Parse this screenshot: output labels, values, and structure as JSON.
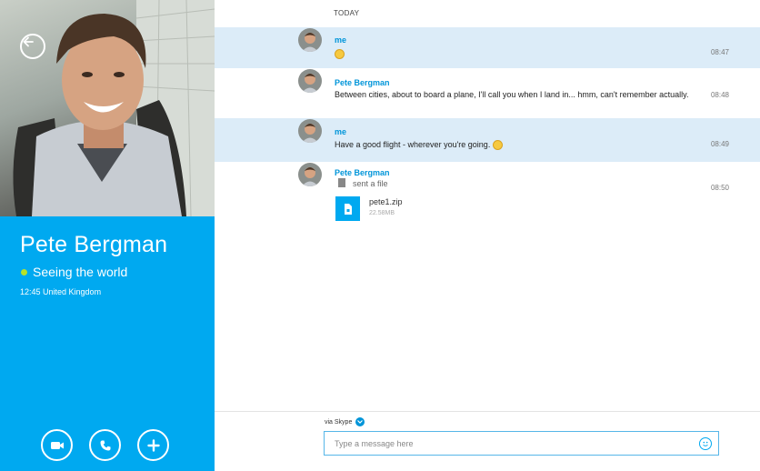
{
  "contact": {
    "name": "Pete Bergman",
    "mood": "Seeing the world",
    "local_info": "12:45 United Kingdom"
  },
  "icons": {
    "back": "back-arrow-icon",
    "video": "video-call-icon",
    "call": "phone-icon",
    "add": "plus-icon"
  },
  "colors": {
    "accent": "#00a9f0",
    "sender": "#0095d9",
    "mine_bg": "#dcecf8",
    "status_online": "#b6e22a"
  },
  "conversation": {
    "day_label": "TODAY",
    "messages": [
      {
        "sender": "me",
        "text": "",
        "emoticon": "smile",
        "time": "08:47"
      },
      {
        "sender": "Pete Bergman",
        "text": "Between cities, about to board a plane, I'll call you when I land in... hmm, can't remember actually.",
        "time": "08:48"
      },
      {
        "sender": "me",
        "text": "Have a good flight - wherever you're going.",
        "emoticon": "grin",
        "time": "08:49"
      },
      {
        "sender": "Pete Bergman",
        "text": "sent a file",
        "time": "08:50",
        "file": {
          "name": "pete1.zip",
          "size": "22.58MB"
        }
      }
    ]
  },
  "composer": {
    "via_label": "via Skype",
    "placeholder": "Type a message here"
  }
}
